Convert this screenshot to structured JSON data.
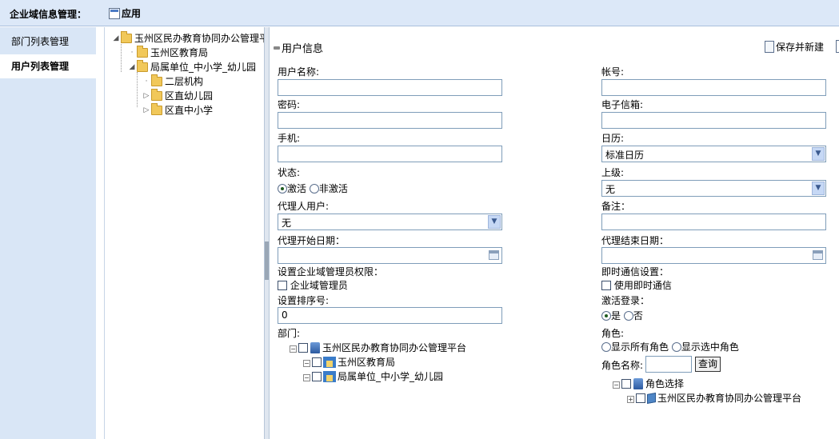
{
  "topbar": {
    "title": "企业域信息管理：",
    "apply_label": "应用"
  },
  "leftnav": {
    "items": [
      {
        "label": "部门列表管理"
      },
      {
        "label": "用户列表管理"
      }
    ]
  },
  "tree": {
    "root": "玉州区民办教育协同办公管理平台",
    "child1": "玉州区教育局",
    "child2": "局属单位_中小学_幼儿园",
    "grand1": "二层机构",
    "grand2": "区直幼儿园",
    "grand3": "区直中小学"
  },
  "form": {
    "section_title": "用户信息",
    "save_label": "保存并新建",
    "username": {
      "label": "用户名称:",
      "value": ""
    },
    "account": {
      "label": "帐号:",
      "value": ""
    },
    "password": {
      "label": "密码:",
      "value": ""
    },
    "email": {
      "label": "电子信箱:",
      "value": ""
    },
    "mobile": {
      "label": "手机:",
      "value": ""
    },
    "calendar": {
      "label": "日历:",
      "value": "标准日历"
    },
    "status": {
      "label": "状态:",
      "option_active": "激活",
      "option_inactive": "非激活",
      "selected": "激活"
    },
    "superior": {
      "label": "上级:",
      "value": "无"
    },
    "proxy_user": {
      "label": "代理人用户:",
      "value": "无"
    },
    "remark": {
      "label": "备注：",
      "value": ""
    },
    "proxy_start": {
      "label": "代理开始日期：",
      "value": ""
    },
    "proxy_end": {
      "label": "代理结束日期：",
      "value": ""
    },
    "admin_perm": {
      "label": "设置企业域管理员权限：",
      "checkbox_label": "企业域管理员"
    },
    "im_setting": {
      "label": "即时通信设置：",
      "checkbox_label": "使用即时通信"
    },
    "sort_no": {
      "label": "设置排序号:",
      "value": "0"
    },
    "activate_login": {
      "label": "激活登录：",
      "option_yes": "是",
      "option_no": "否",
      "selected": "是"
    },
    "dept": {
      "label": "部门:",
      "root": "玉州区民办教育协同办公管理平台",
      "child1": "玉州区教育局",
      "child2": "局属单位_中小学_幼儿园"
    },
    "role": {
      "label": "角色:",
      "option_all": "显示所有角色",
      "option_selected": "显示选中角色",
      "name_label": "角色名称:",
      "name_value": "",
      "query_label": "查询",
      "tree_root": "角色选择",
      "tree_child": "玉州区民办教育协同办公管理平台"
    }
  }
}
